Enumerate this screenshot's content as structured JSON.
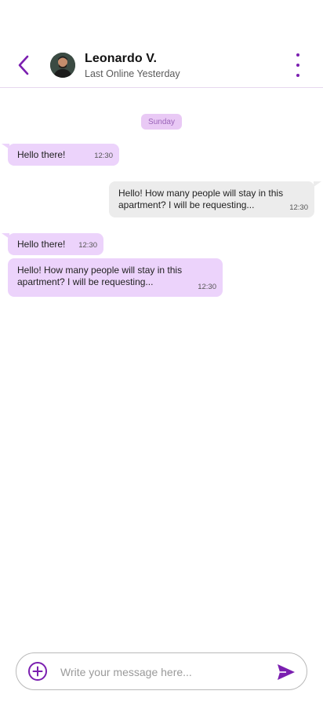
{
  "header": {
    "contact_name": "Leonardo V.",
    "contact_status": "Last Online Yesterday",
    "back_icon": "chevron-left-icon",
    "more_icon": "more-vertical-icon"
  },
  "chat": {
    "day_label": "Sunday",
    "messages": [
      {
        "direction": "incoming",
        "text": "Hello there!",
        "time": "12:30"
      },
      {
        "direction": "outgoing",
        "text": "Hello! How many people will stay in this apartment? I will be requesting...",
        "time": "12:30"
      },
      {
        "direction": "incoming",
        "text": "Hello there!",
        "time": "12:30"
      },
      {
        "direction": "incoming",
        "text": "Hello! How many people will stay in this apartment? I will be requesting...",
        "time": "12:30"
      }
    ]
  },
  "composer": {
    "placeholder": "Write your message here...",
    "value": "",
    "add_icon": "plus-circle-icon",
    "send_icon": "send-icon"
  },
  "colors": {
    "accent": "#7b1fb0",
    "incoming_bubble": "#ecd3fb",
    "outgoing_bubble": "#ececec",
    "day_chip": "#e9c9f5"
  }
}
